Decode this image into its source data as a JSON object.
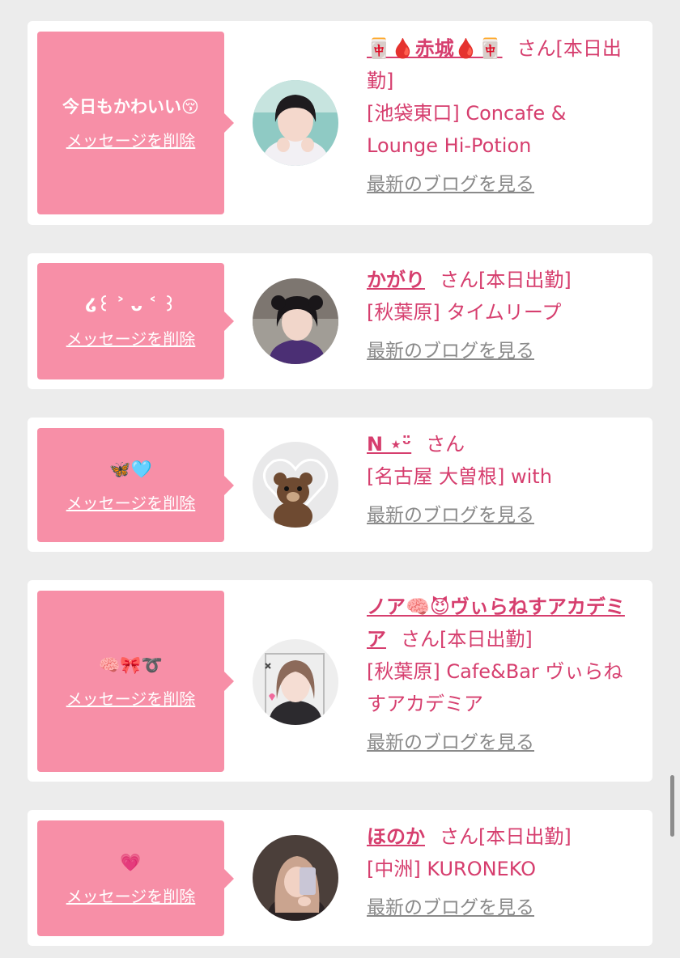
{
  "delete_label": "メッセージを削除",
  "blog_label": "最新のブログを見る",
  "accent_color": "#d63e6e",
  "bubble_color": "#f78fa7",
  "cards": [
    {
      "message": "今日もかわいい😚",
      "name": "🀄🩸赤城🩸🀄",
      "suffix": "さん[本日出勤]",
      "shop": "[池袋東口] Concafe & Lounge Hi-Potion"
    },
    {
      "message": "໒꒰ ˃ ᴗ ˂ ꒱",
      "name": "かがり",
      "suffix": "さん[本日出勤]",
      "shop": "[秋葉原] タイムリープ"
    },
    {
      "message": "🦋🩵",
      "name": "N ⋆ᵕ̈",
      "suffix": "さん",
      "shop": "[名古屋 大曽根] with"
    },
    {
      "message": "🧠🎀➰",
      "name": "ノア🧠😈ヴぃらねすアカデミア",
      "suffix": "さん[本日出勤]",
      "shop": "[秋葉原] Cafe&Bar ヴぃらねすアカデミア"
    },
    {
      "message": "💗",
      "name": "ほのか",
      "suffix": "さん[本日出勤]",
      "shop": "[中洲] KURONEKO"
    }
  ]
}
